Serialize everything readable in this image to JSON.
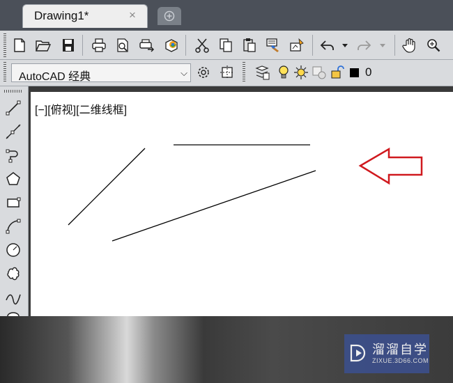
{
  "tabs": {
    "active_label": "Drawing1*",
    "close_glyph": "×"
  },
  "workspace": {
    "selected": "AutoCAD 经典"
  },
  "layer": {
    "name": "0",
    "color": "#000000"
  },
  "viewport": {
    "label": "[−][俯视][二维线框]"
  },
  "watermark": {
    "title": "溜溜自学",
    "url": "ZIXUE.3D66.COM"
  },
  "colors": {
    "arrow": "#d0191e",
    "canvas": "#ffffff",
    "watermark_bg": "#3c4f8a"
  },
  "icons": {
    "toolbar1": [
      "new-icon",
      "open-icon",
      "save-icon",
      "plot-icon",
      "plot-preview-icon",
      "publish-icon",
      "3d-dwf-icon",
      "cut-icon",
      "copy-icon",
      "paste-icon",
      "match-properties-icon",
      "block-editor-icon",
      "undo-icon",
      "redo-icon",
      "pan-icon",
      "zoom-realtime-icon"
    ],
    "toolbar2": [
      "workspace-settings-icon",
      "customize-icon",
      "layer-properties-icon",
      "layer-on-icon",
      "layer-freeze-icon",
      "layer-viewport-icon",
      "layer-lock-icon"
    ],
    "draw": [
      "line-icon",
      "construction-line-icon",
      "polyline-icon",
      "polygon-icon",
      "rectangle-icon",
      "arc-icon",
      "circle-icon",
      "revision-cloud-icon",
      "spline-icon",
      "ellipse-icon"
    ]
  }
}
